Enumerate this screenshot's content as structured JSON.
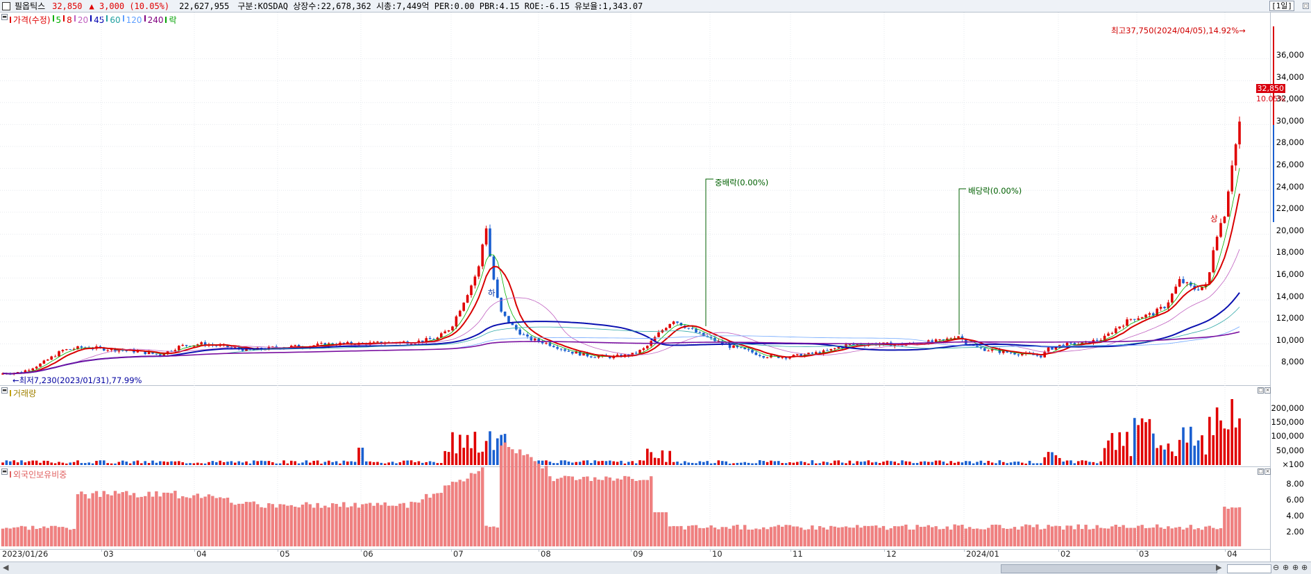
{
  "header": {
    "name": "필옵틱스",
    "price": "32,850",
    "change": "▲ 3,000 (10.05%)",
    "volume": "22,627,955",
    "info": "구분:KOSDAQ 상장수:22,678,362 시총:7,449억 PER:0.00 PBR:4.15 ROE:-6.15 유보율:1,343.07",
    "period": "[1일]"
  },
  "legend_price": {
    "title": "가격(수정)",
    "ma": [
      {
        "label": "5",
        "color": "#00b000"
      },
      {
        "label": "8",
        "color": "#e00000"
      },
      {
        "label": "20",
        "color": "#c060c0"
      },
      {
        "label": "45",
        "color": "#0000b0"
      },
      {
        "label": "60",
        "color": "#20a0a0"
      },
      {
        "label": "120",
        "color": "#60a0ff"
      },
      {
        "label": "240",
        "color": "#800080"
      }
    ],
    "rak": "락"
  },
  "legend_volume": "거래량",
  "legend_foreign": "외국인보유비중",
  "y_price": [
    "36,000",
    "34,000",
    "32,000",
    "30,000",
    "28,000",
    "26,000",
    "24,000",
    "22,000",
    "20,000",
    "18,000",
    "16,000",
    "14,000",
    "12,000",
    "10,000",
    "8,000"
  ],
  "y_volume": [
    "200,000",
    "150,000",
    "100,000",
    "50,000",
    "×100"
  ],
  "y_foreign": [
    "8.00",
    "6.00",
    "4.00",
    "2.00"
  ],
  "x_labels": [
    "2023/01/26",
    "03",
    "04",
    "05",
    "06",
    "07",
    "08",
    "09",
    "10",
    "11",
    "12",
    "2024/01",
    "02",
    "03",
    "04"
  ],
  "annotations": {
    "high": "최고37,750(2024/04/05),14.92%→",
    "low": "←최저7,230(2023/01/31),77.99%",
    "rights": "중배락(0.00%)",
    "dividend": "배당락(0.00%)",
    "upper_limit": "상",
    "lower_limit": "하"
  },
  "price_box": {
    "value": "32,850",
    "pct": "10.05%"
  },
  "colors": {
    "up": "#e00000",
    "down": "#1a5fd0",
    "foreign_bar": "#f08080"
  }
}
